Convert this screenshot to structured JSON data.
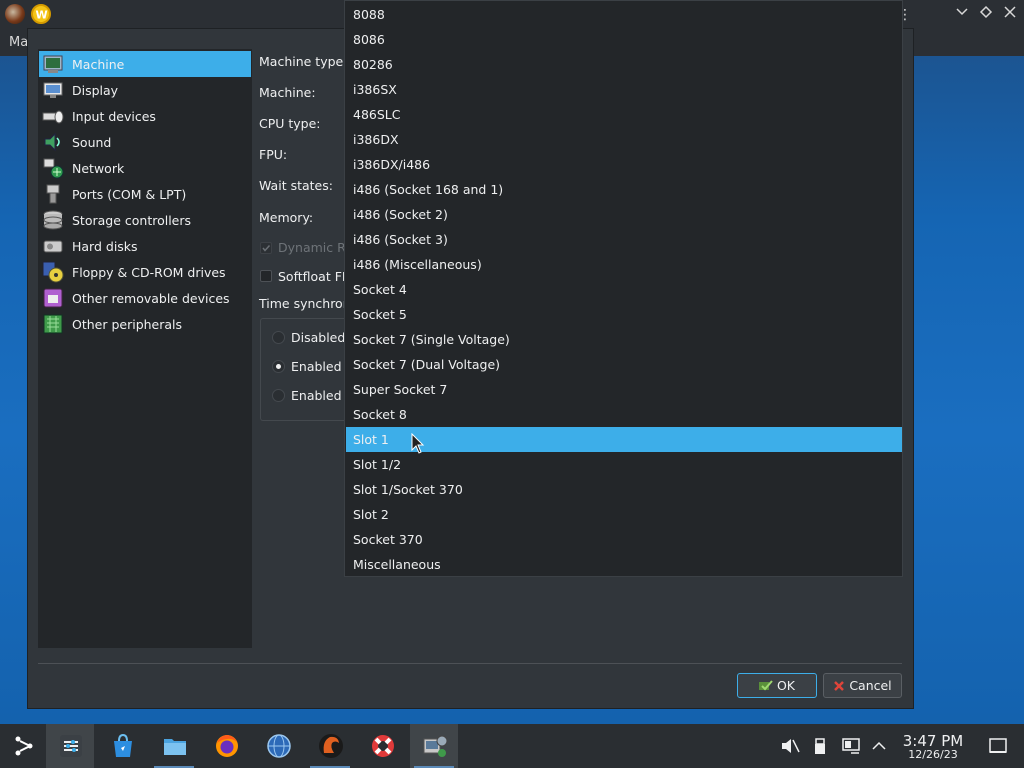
{
  "window": {
    "menu_fragment": "Ma"
  },
  "sidebar": {
    "items": [
      {
        "label": "Machine",
        "icon": "machine-icon",
        "selected": true
      },
      {
        "label": "Display",
        "icon": "display-icon"
      },
      {
        "label": "Input devices",
        "icon": "input-devices-icon"
      },
      {
        "label": "Sound",
        "icon": "sound-icon"
      },
      {
        "label": "Network",
        "icon": "network-icon"
      },
      {
        "label": "Ports (COM & LPT)",
        "icon": "ports-icon"
      },
      {
        "label": "Storage controllers",
        "icon": "storage-controllers-icon"
      },
      {
        "label": "Hard disks",
        "icon": "hard-disks-icon"
      },
      {
        "label": "Floppy & CD-ROM drives",
        "icon": "floppy-cdrom-icon"
      },
      {
        "label": "Other removable devices",
        "icon": "removable-devices-icon"
      },
      {
        "label": "Other peripherals",
        "icon": "other-peripherals-icon"
      }
    ]
  },
  "form": {
    "machine_type_label": "Machine type:",
    "machine_label": "Machine:",
    "cpu_type_label": "CPU type:",
    "fpu_label": "FPU:",
    "wait_states_label": "Wait states:",
    "memory_label": "Memory:",
    "dynamic_recompiler_label": "Dynamic Re",
    "softfloat_label": "Softfloat FPU",
    "time_sync_label": "Time synchroni",
    "time_sync_options": [
      {
        "label": "Disabled",
        "checked": false
      },
      {
        "label": "Enabled (",
        "checked": true
      },
      {
        "label": "Enabled (",
        "checked": false
      }
    ]
  },
  "dropdown": {
    "selected_index": 17,
    "options": [
      "8088",
      "8086",
      "80286",
      "i386SX",
      "486SLC",
      "i386DX",
      "i386DX/i486",
      "i486 (Socket 168 and 1)",
      "i486 (Socket 2)",
      "i486 (Socket 3)",
      "i486 (Miscellaneous)",
      "Socket 4",
      "Socket 5",
      "Socket 7 (Single Voltage)",
      "Socket 7 (Dual Voltage)",
      "Super Socket 7",
      "Socket 8",
      "Slot 1",
      "Slot 1/2",
      "Slot 1/Socket 370",
      "Slot 2",
      "Socket 370",
      "Miscellaneous"
    ]
  },
  "buttons": {
    "ok": "OK",
    "cancel": "Cancel"
  },
  "taskbar": {
    "apps": [
      "application-launcher-icon",
      "system-settings-icon",
      "discover-store-icon",
      "dolphin-files-icon",
      "firefox-icon",
      "network-browser-icon",
      "86box-manager-icon",
      "help-lifebuoy-icon",
      "86box-settings-icon"
    ],
    "tray": [
      "volume-muted-icon",
      "removable-device-icon",
      "network-icon",
      "show-hidden-icon"
    ],
    "time": "3:47 PM",
    "date": "12/26/23"
  },
  "colors": {
    "accent": "#3daee9",
    "window_bg": "#31363b",
    "view_bg": "#232629",
    "taskbar": "#2a2e32"
  }
}
